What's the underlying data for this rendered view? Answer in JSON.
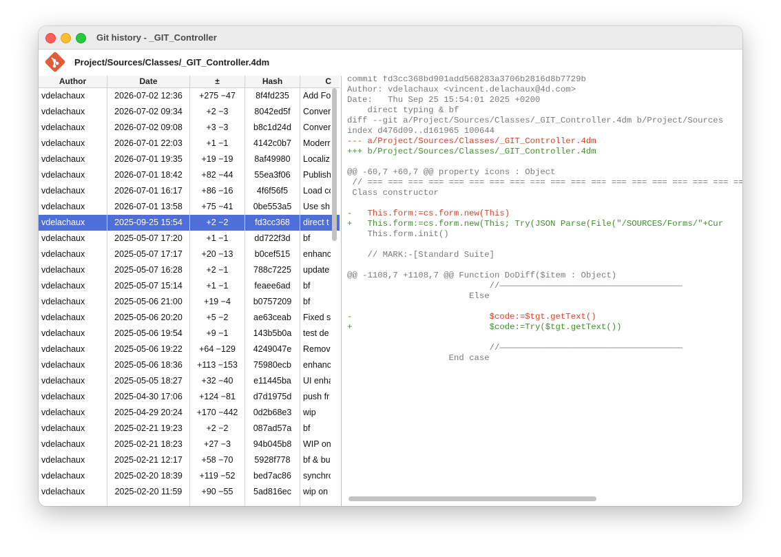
{
  "window": {
    "title": "Git history - _GIT_Controller",
    "path": "Project/Sources/Classes/_GIT_Controller.4dm",
    "brand_color": "#e05d3a",
    "selection_color": "#4f6ed7"
  },
  "columns": [
    "Author",
    "Date",
    "±",
    "Hash",
    "C"
  ],
  "commits": [
    {
      "author": "vdelachaux",
      "date": "2026-07-02 12:36",
      "diff": "+275 −47",
      "hash": "8f4fd235",
      "message": "Add Fo"
    },
    {
      "author": "vdelachaux",
      "date": "2026-07-02 09:34",
      "diff": "+2 −3",
      "hash": "8042ed5f",
      "message": "Conver"
    },
    {
      "author": "vdelachaux",
      "date": "2026-07-02 09:08",
      "diff": "+3 −3",
      "hash": "b8c1d24d",
      "message": "Conver"
    },
    {
      "author": "vdelachaux",
      "date": "2026-07-01 22:03",
      "diff": "+1 −1",
      "hash": "4142c0b7",
      "message": "Moderr"
    },
    {
      "author": "vdelachaux",
      "date": "2026-07-01 19:35",
      "diff": "+19 −19",
      "hash": "8af49980",
      "message": "Localiz"
    },
    {
      "author": "vdelachaux",
      "date": "2026-07-01 18:42",
      "diff": "+82 −44",
      "hash": "55ea3f06",
      "message": "Publish"
    },
    {
      "author": "vdelachaux",
      "date": "2026-07-01 16:17",
      "diff": "+86 −16",
      "hash": "4f6f56f5",
      "message": "Load co"
    },
    {
      "author": "vdelachaux",
      "date": "2026-07-01 13:58",
      "diff": "+75 −41",
      "hash": "0be553a5",
      "message": "Use sh"
    },
    {
      "author": "vdelachaux",
      "date": "2025-09-25 15:54",
      "diff": "+2 −2",
      "hash": "fd3cc368",
      "message": "direct t"
    },
    {
      "author": "vdelachaux",
      "date": "2025-05-07 17:20",
      "diff": "+1 −1",
      "hash": "dd722f3d",
      "message": "bf"
    },
    {
      "author": "vdelachaux",
      "date": "2025-05-07 17:17",
      "diff": "+20 −13",
      "hash": "b0cef515",
      "message": "enhanc"
    },
    {
      "author": "vdelachaux",
      "date": "2025-05-07 16:28",
      "diff": "+2 −1",
      "hash": "788c7225",
      "message": "update"
    },
    {
      "author": "vdelachaux",
      "date": "2025-05-07 15:14",
      "diff": "+1 −1",
      "hash": "feaee6ad",
      "message": "bf"
    },
    {
      "author": "vdelachaux",
      "date": "2025-05-06 21:00",
      "diff": "+19 −4",
      "hash": "b0757209",
      "message": "bf"
    },
    {
      "author": "vdelachaux",
      "date": "2025-05-06 20:20",
      "diff": "+5 −2",
      "hash": "ae63ceab",
      "message": "Fixed s"
    },
    {
      "author": "vdelachaux",
      "date": "2025-05-06 19:54",
      "diff": "+9 −1",
      "hash": "143b5b0a",
      "message": "test de"
    },
    {
      "author": "vdelachaux",
      "date": "2025-05-06 19:22",
      "diff": "+64 −129",
      "hash": "4249047e",
      "message": "Remov"
    },
    {
      "author": "vdelachaux",
      "date": "2025-05-06 18:36",
      "diff": "+113 −153",
      "hash": "75980ecb",
      "message": "enhanc"
    },
    {
      "author": "vdelachaux",
      "date": "2025-05-05 18:27",
      "diff": "+32 −40",
      "hash": "e11445ba",
      "message": "UI enha"
    },
    {
      "author": "vdelachaux",
      "date": "2025-04-30 17:06",
      "diff": "+124 −81",
      "hash": "d7d1975d",
      "message": "push fr"
    },
    {
      "author": "vdelachaux",
      "date": "2025-04-29 20:24",
      "diff": "+170 −442",
      "hash": "0d2b68e3",
      "message": "wip"
    },
    {
      "author": "vdelachaux",
      "date": "2025-02-21 19:23",
      "diff": "+2 −2",
      "hash": "087ad57a",
      "message": "bf"
    },
    {
      "author": "vdelachaux",
      "date": "2025-02-21 18:23",
      "diff": "+27 −3",
      "hash": "94b045b8",
      "message": "WIP on"
    },
    {
      "author": "vdelachaux",
      "date": "2025-02-21 12:17",
      "diff": "+58 −70",
      "hash": "5928f778",
      "message": "bf & bu"
    },
    {
      "author": "vdelachaux",
      "date": "2025-02-20 18:39",
      "diff": "+119 −52",
      "hash": "bed7ac86",
      "message": "synchro"
    },
    {
      "author": "vdelachaux",
      "date": "2025-02-20 11:59",
      "diff": "+90 −55",
      "hash": "5ad816ec",
      "message": "wip on"
    }
  ],
  "selected_index": 8,
  "diff_lines": [
    {
      "type": "meta",
      "text": "commit fd3cc368bd901add568283a3706b2816d8b7729b"
    },
    {
      "type": "meta",
      "text": "Author: vdelachaux <vincent.delachaux@4d.com>"
    },
    {
      "type": "meta",
      "text": "Date:   Thu Sep 25 15:54:01 2025 +0200"
    },
    {
      "type": "meta",
      "text": "    direct typing & bf"
    },
    {
      "type": "meta",
      "text": "diff --git a/Project/Sources/Classes/_GIT_Controller.4dm b/Project/Sources"
    },
    {
      "type": "meta",
      "text": "index d476d09..d161965 100644"
    },
    {
      "type": "del",
      "text": "--- a/Project/Sources/Classes/_GIT_Controller.4dm"
    },
    {
      "type": "add",
      "text": "+++ b/Project/Sources/Classes/_GIT_Controller.4dm"
    },
    {
      "type": "ctx",
      "text": ""
    },
    {
      "type": "meta",
      "text": "@@ -60,7 +60,7 @@ property icons : Object"
    },
    {
      "type": "ctx",
      "text": " // === === === === === === === === === === === === === === === === === === ==="
    },
    {
      "type": "ctx",
      "text": " Class constructor"
    },
    {
      "type": "ctx",
      "text": ""
    },
    {
      "type": "del",
      "text": "-   This.form:=cs.form.new(This)"
    },
    {
      "type": "add",
      "text": "+   This.form:=cs.form.new(This; Try(JSON Parse(File(\"/SOURCES/Forms/\"+Cur"
    },
    {
      "type": "ctx",
      "text": "    This.form.init()"
    },
    {
      "type": "ctx",
      "text": ""
    },
    {
      "type": "ctx",
      "text": "    // MARK:-[Standard Suite]"
    },
    {
      "type": "ctx",
      "text": ""
    },
    {
      "type": "meta",
      "text": "@@ -1108,7 +1108,7 @@ Function DoDiff($item : Object)"
    },
    {
      "type": "ctx",
      "text": "                            //————————————————————————————————————"
    },
    {
      "type": "ctx",
      "text": "                        Else"
    },
    {
      "type": "ctx",
      "text": ""
    },
    {
      "type": "del",
      "text": "-                           $code:=$tgt.getText()"
    },
    {
      "type": "add",
      "text": "+                           $code:=Try($tgt.getText())"
    },
    {
      "type": "ctx",
      "text": ""
    },
    {
      "type": "ctx",
      "text": "                            //————————————————————————————————————"
    },
    {
      "type": "ctx",
      "text": "                    End case"
    }
  ]
}
